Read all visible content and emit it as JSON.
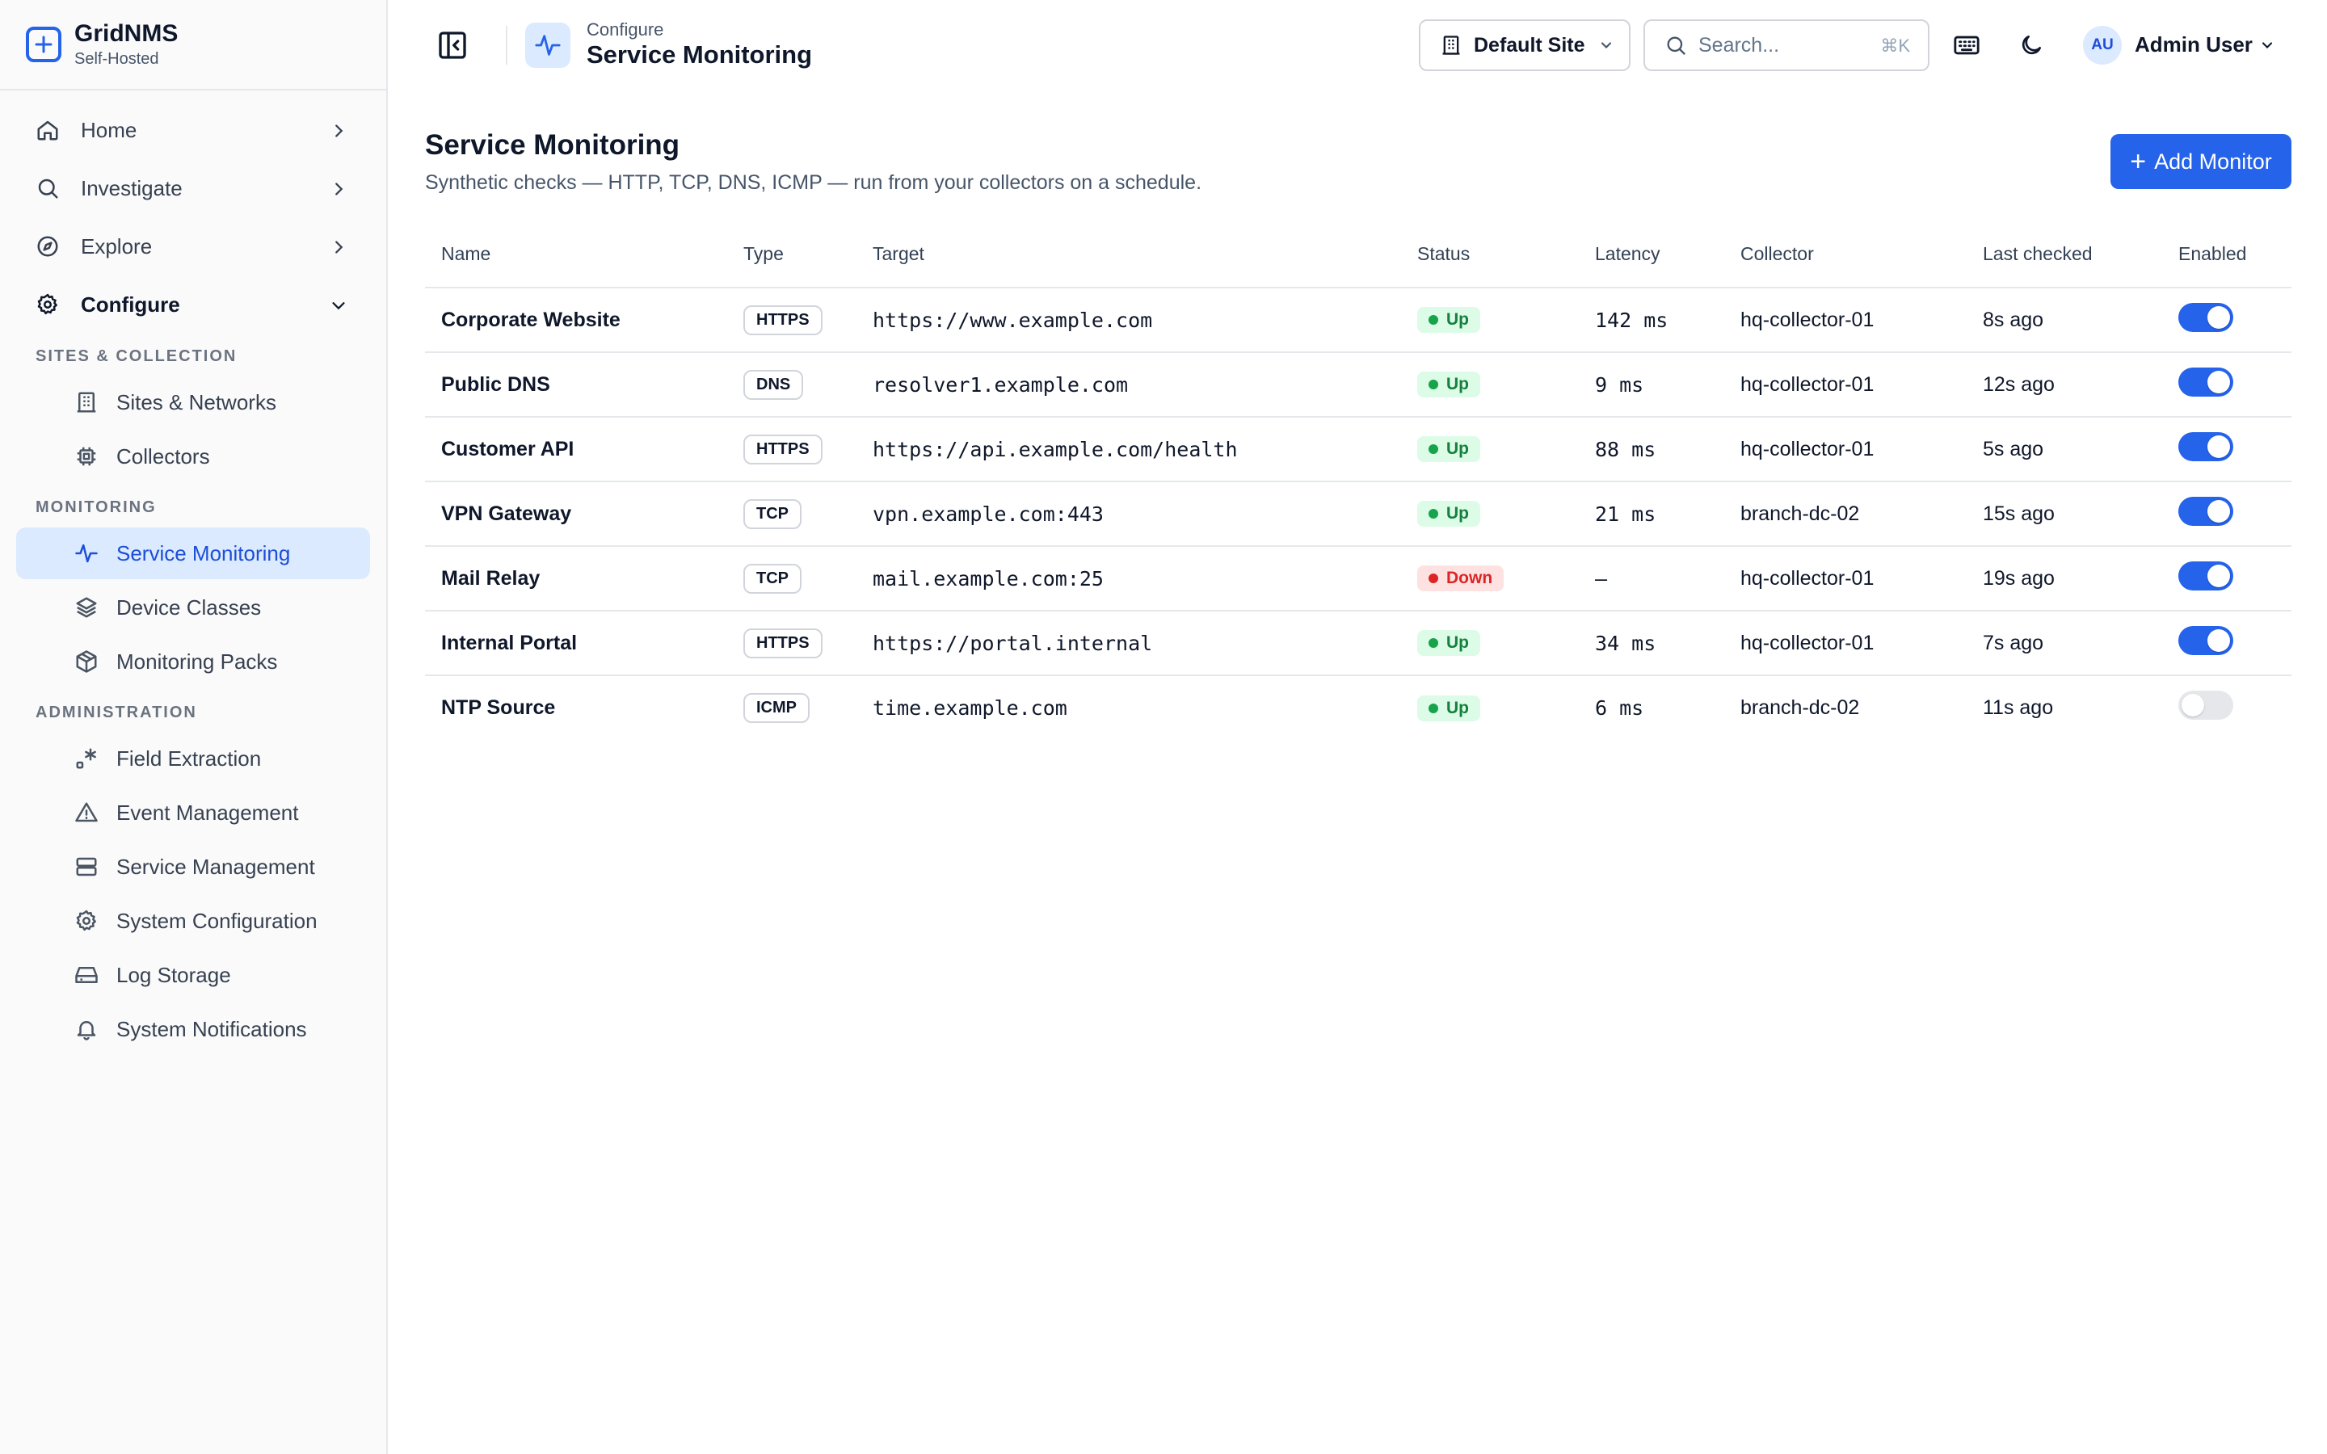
{
  "brand": {
    "name": "GridNMS",
    "subtitle": "Self-Hosted"
  },
  "sidebar": {
    "top_items": [
      {
        "label": "Home",
        "icon": "home-icon"
      },
      {
        "label": "Investigate",
        "icon": "search-icon"
      },
      {
        "label": "Explore",
        "icon": "compass-icon"
      },
      {
        "label": "Configure",
        "icon": "gear-icon",
        "expanded": true
      }
    ],
    "sections": [
      {
        "label": "SITES & COLLECTION",
        "items": [
          {
            "label": "Sites & Networks",
            "icon": "building-icon"
          },
          {
            "label": "Collectors",
            "icon": "chip-icon"
          }
        ]
      },
      {
        "label": "MONITORING",
        "items": [
          {
            "label": "Service Monitoring",
            "icon": "activity-icon",
            "active": true
          },
          {
            "label": "Device Classes",
            "icon": "layers-icon"
          },
          {
            "label": "Monitoring Packs",
            "icon": "package-icon"
          }
        ]
      },
      {
        "label": "ADMINISTRATION",
        "items": [
          {
            "label": "Field Extraction",
            "icon": "field-extraction-icon"
          },
          {
            "label": "Event Management",
            "icon": "warning-icon"
          },
          {
            "label": "Service Management",
            "icon": "server-icon"
          },
          {
            "label": "System Configuration",
            "icon": "gear-icon"
          },
          {
            "label": "Log Storage",
            "icon": "hard-drive-icon"
          },
          {
            "label": "System Notifications",
            "icon": "bell-icon"
          }
        ]
      }
    ]
  },
  "header": {
    "breadcrumb_parent": "Configure",
    "breadcrumb_title": "Service Monitoring",
    "site_selector": "Default Site",
    "search_placeholder": "Search...",
    "search_shortcut": "⌘K",
    "user_initials": "AU",
    "user_name": "Admin User"
  },
  "page": {
    "title": "Service Monitoring",
    "description": "Synthetic checks — HTTP, TCP, DNS, ICMP — run from your collectors on a schedule.",
    "add_button": "Add Monitor"
  },
  "table": {
    "columns": [
      "Name",
      "Type",
      "Target",
      "Status",
      "Latency",
      "Collector",
      "Last checked",
      "Enabled"
    ],
    "rows": [
      {
        "name": "Corporate Website",
        "type": "HTTPS",
        "target": "https://www.example.com",
        "status": "Up",
        "latency": "142 ms",
        "collector": "hq-collector-01",
        "last_checked": "8s ago",
        "enabled": true
      },
      {
        "name": "Public DNS",
        "type": "DNS",
        "target": "resolver1.example.com",
        "status": "Up",
        "latency": "9 ms",
        "collector": "hq-collector-01",
        "last_checked": "12s ago",
        "enabled": true
      },
      {
        "name": "Customer API",
        "type": "HTTPS",
        "target": "https://api.example.com/health",
        "status": "Up",
        "latency": "88 ms",
        "collector": "hq-collector-01",
        "last_checked": "5s ago",
        "enabled": true
      },
      {
        "name": "VPN Gateway",
        "type": "TCP",
        "target": "vpn.example.com:443",
        "status": "Up",
        "latency": "21 ms",
        "collector": "branch-dc-02",
        "last_checked": "15s ago",
        "enabled": true
      },
      {
        "name": "Mail Relay",
        "type": "TCP",
        "target": "mail.example.com:25",
        "status": "Down",
        "latency": "—",
        "collector": "hq-collector-01",
        "last_checked": "19s ago",
        "enabled": true
      },
      {
        "name": "Internal Portal",
        "type": "HTTPS",
        "target": "https://portal.internal",
        "status": "Up",
        "latency": "34 ms",
        "collector": "hq-collector-01",
        "last_checked": "7s ago",
        "enabled": true
      },
      {
        "name": "NTP Source",
        "type": "ICMP",
        "target": "time.example.com",
        "status": "Up",
        "latency": "6 ms",
        "collector": "branch-dc-02",
        "last_checked": "11s ago",
        "enabled": false
      }
    ]
  },
  "colors": {
    "accent": "#2563eb",
    "active_bg": "#dbeafe",
    "status_up": "#16a34a",
    "status_down": "#dc2626"
  }
}
